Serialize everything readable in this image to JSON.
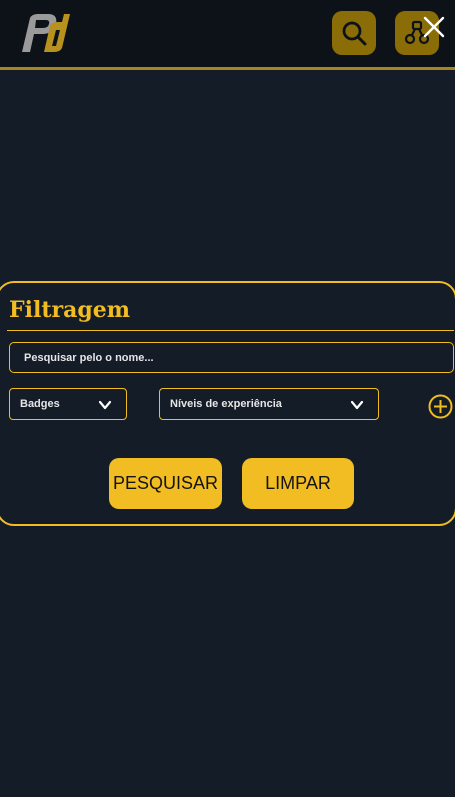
{
  "header": {
    "logo_icon": "pd-logo",
    "search_icon": "search-icon",
    "network_icon": "network-icon",
    "close_icon": "close-icon"
  },
  "filter_panel": {
    "title": "Filtragem",
    "search": {
      "placeholder": "Pesquisar pelo o nome...",
      "value": ""
    },
    "badges_select": {
      "label": "Badges"
    },
    "levels_select": {
      "label": "Níveis de experiência"
    },
    "add_icon": "plus-circle-icon",
    "search_button": "PESQUISAR",
    "clear_button": "LIMPAR"
  },
  "colors": {
    "background": "#141c28",
    "header": "#0d1219",
    "accent": "#f1bd22",
    "accent_dark": "#8b6d08"
  }
}
